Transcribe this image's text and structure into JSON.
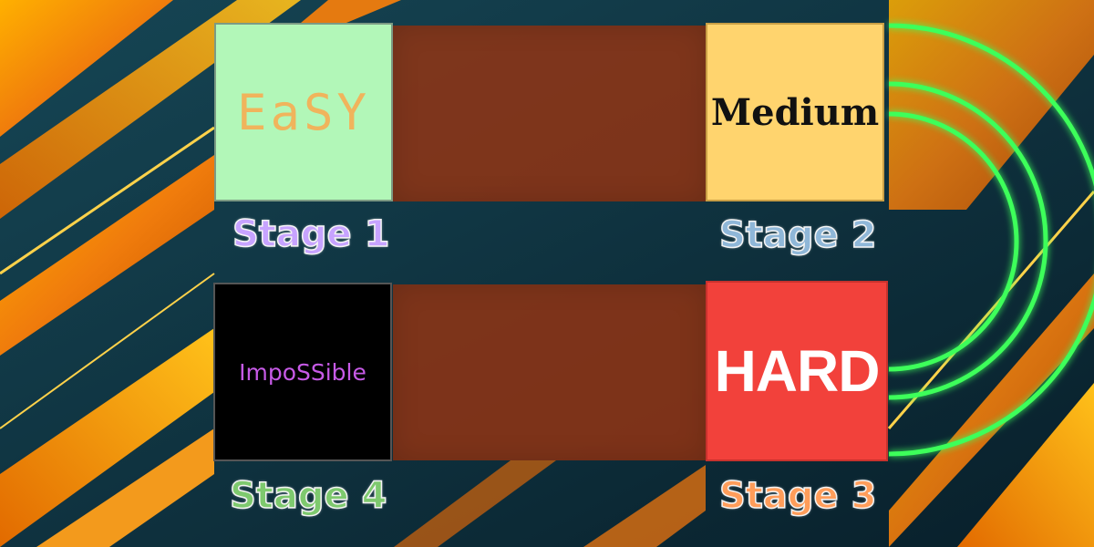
{
  "stages": [
    {
      "difficulty": "EaSY",
      "stage_label": "Stage 1",
      "color": "#b2f7b8"
    },
    {
      "difficulty": "Medium",
      "stage_label": "Stage 2",
      "color": "#ffd46e"
    },
    {
      "difficulty": "HARD",
      "stage_label": "Stage 3",
      "color": "#f2413b"
    },
    {
      "difficulty": "ImpoSSible",
      "stage_label": "Stage 4",
      "color": "#000000"
    }
  ],
  "theme": {
    "background": "#0d2f3d",
    "accent_orange": "#f08a12",
    "glow_green": "#3cff5a",
    "connector": "#96341a"
  }
}
